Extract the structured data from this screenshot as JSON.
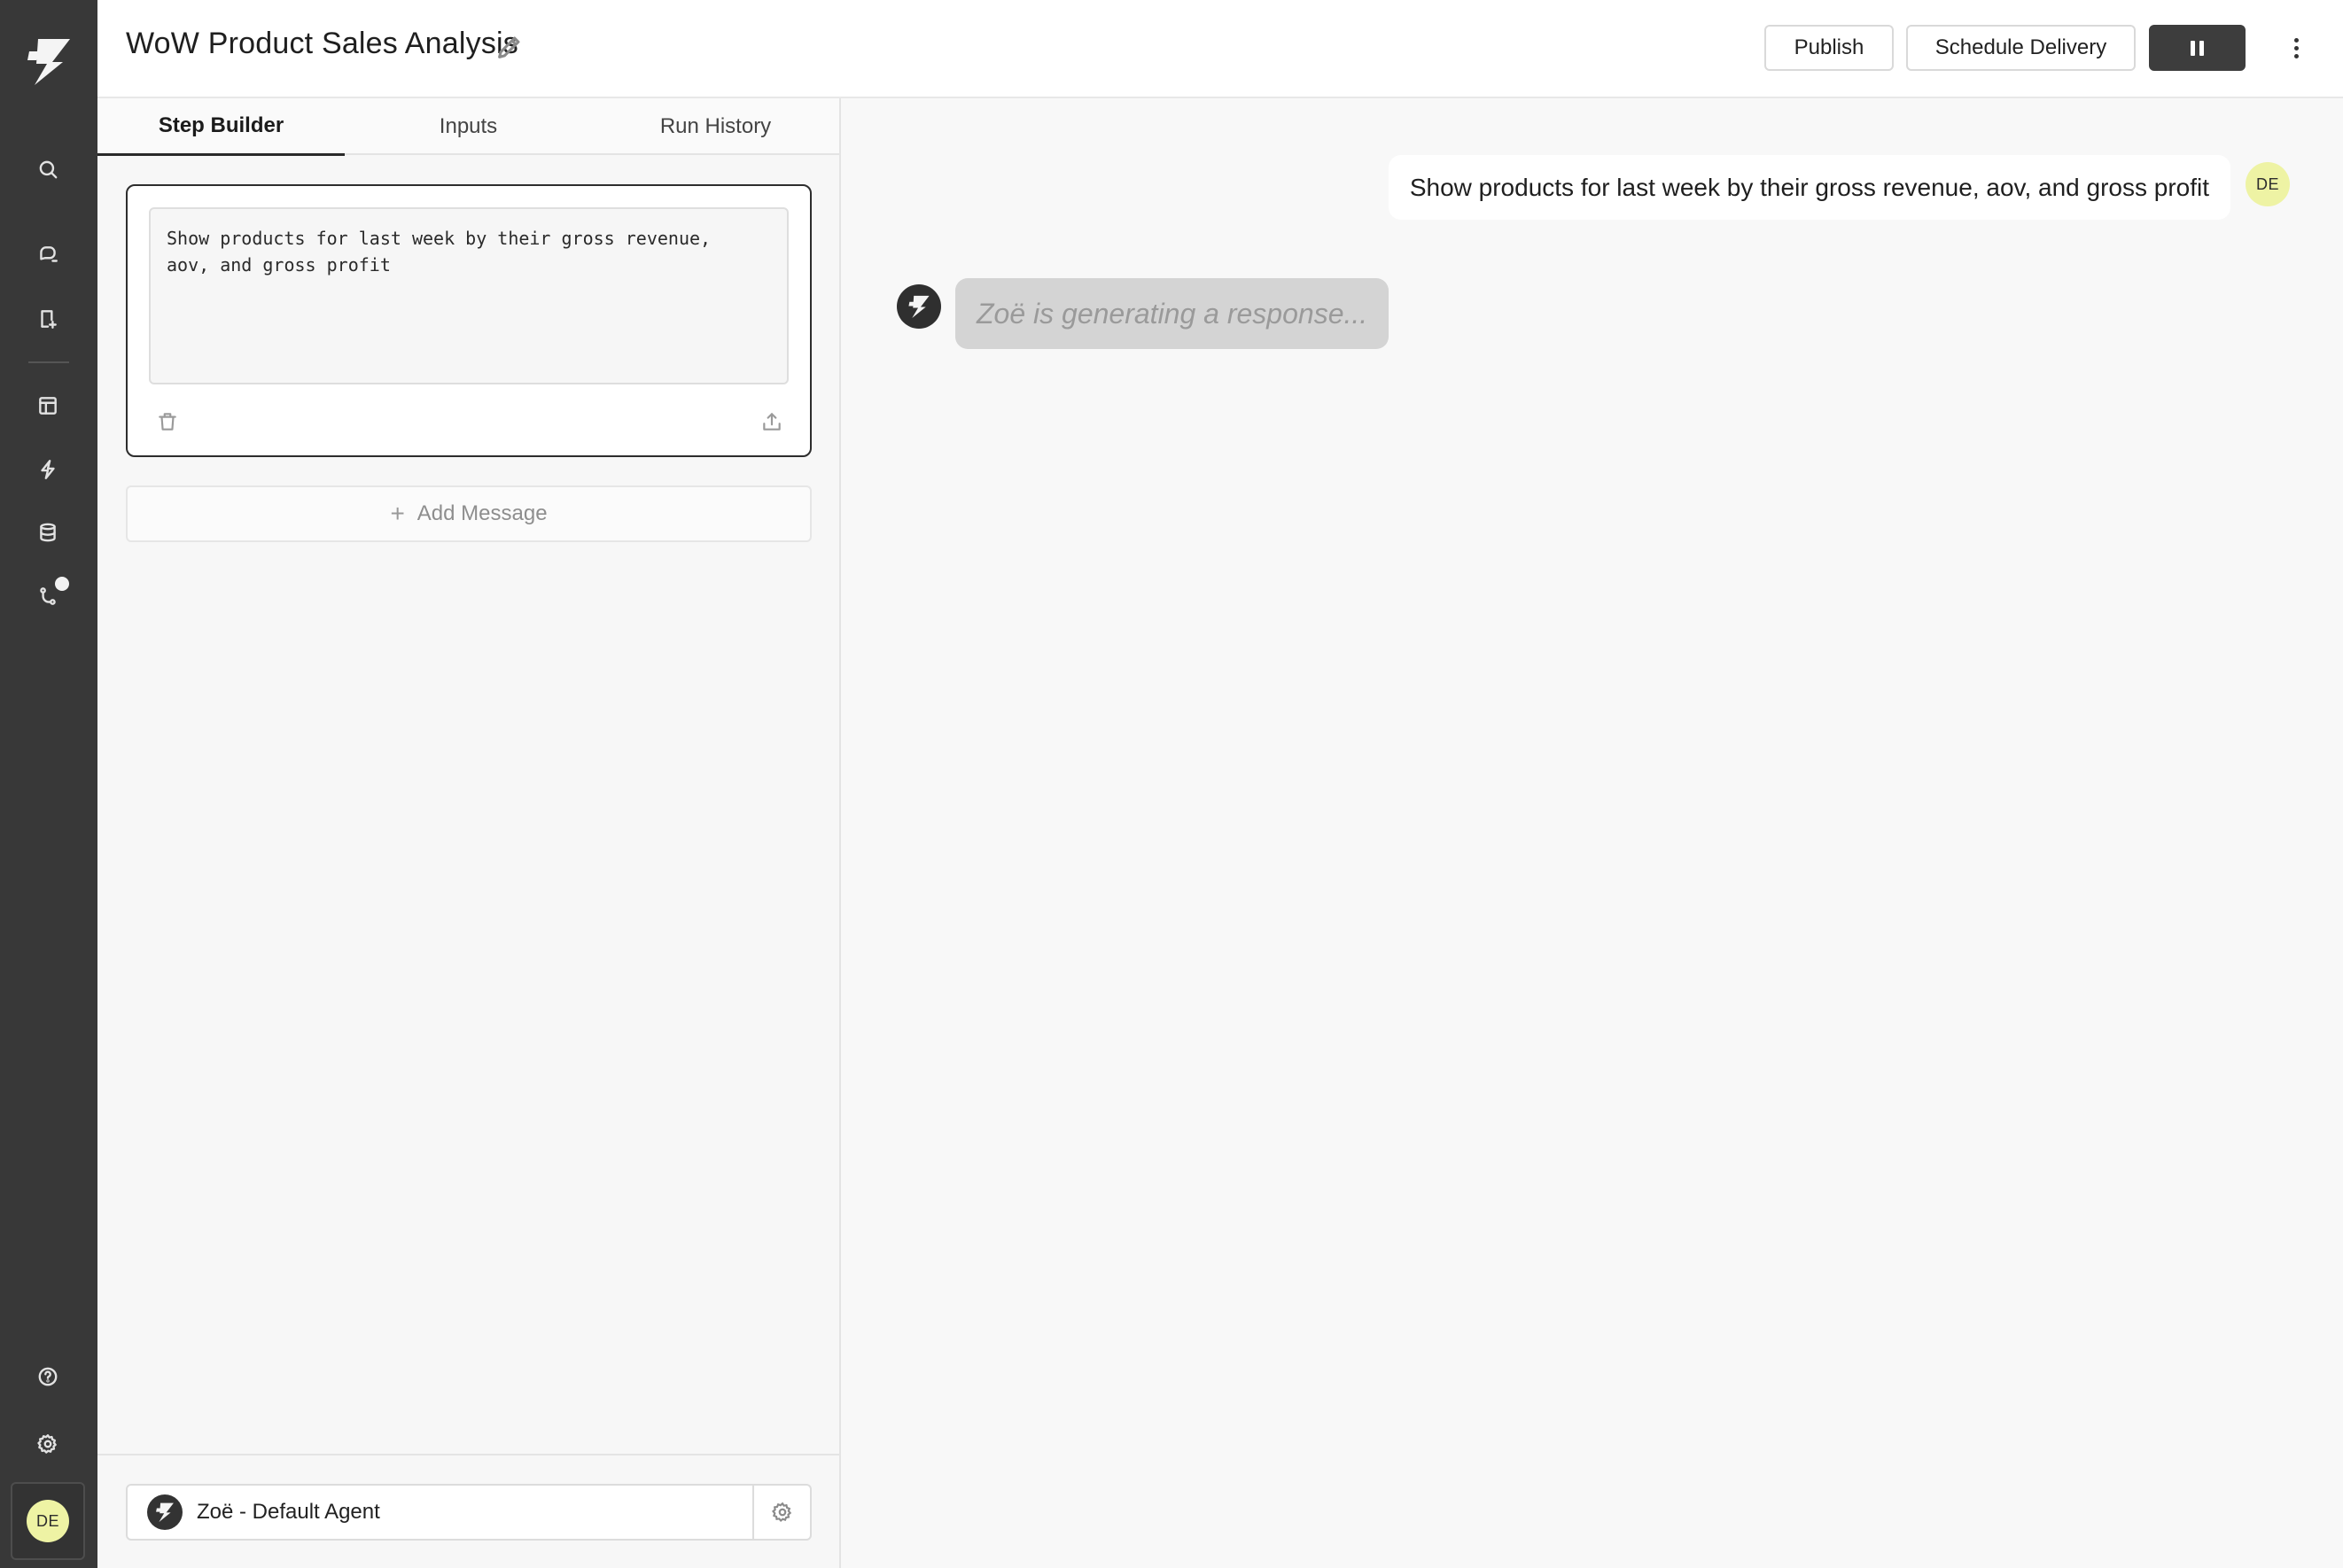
{
  "rail": {
    "icons": [
      "logo-icon",
      "search-icon",
      "chat-icon",
      "report-icon",
      "layout-icon",
      "bolt-icon",
      "database-icon",
      "git-branch-icon",
      "help-icon",
      "gear-icon"
    ],
    "user_initials": "DE"
  },
  "header": {
    "title": "WoW Product Sales Analysis",
    "publish_label": "Publish",
    "schedule_label": "Schedule Delivery"
  },
  "tabs": {
    "step_builder": "Step Builder",
    "inputs": "Inputs",
    "run_history": "Run History",
    "active": "Step Builder"
  },
  "step": {
    "message": "Show products for last week by their gross revenue,\naov, and gross profit"
  },
  "add_message_label": "Add Message",
  "agent": {
    "name": "Zoë - Default Agent"
  },
  "chat": {
    "user_message": "Show products for last week by their gross revenue, aov, and gross profit",
    "user_initials": "DE",
    "bot_status": "Zoë is generating a response..."
  },
  "colors": {
    "rail_bg": "#383838",
    "avatar_bg": "#eef3a4",
    "pause_button_bg": "#3d3d3d"
  }
}
